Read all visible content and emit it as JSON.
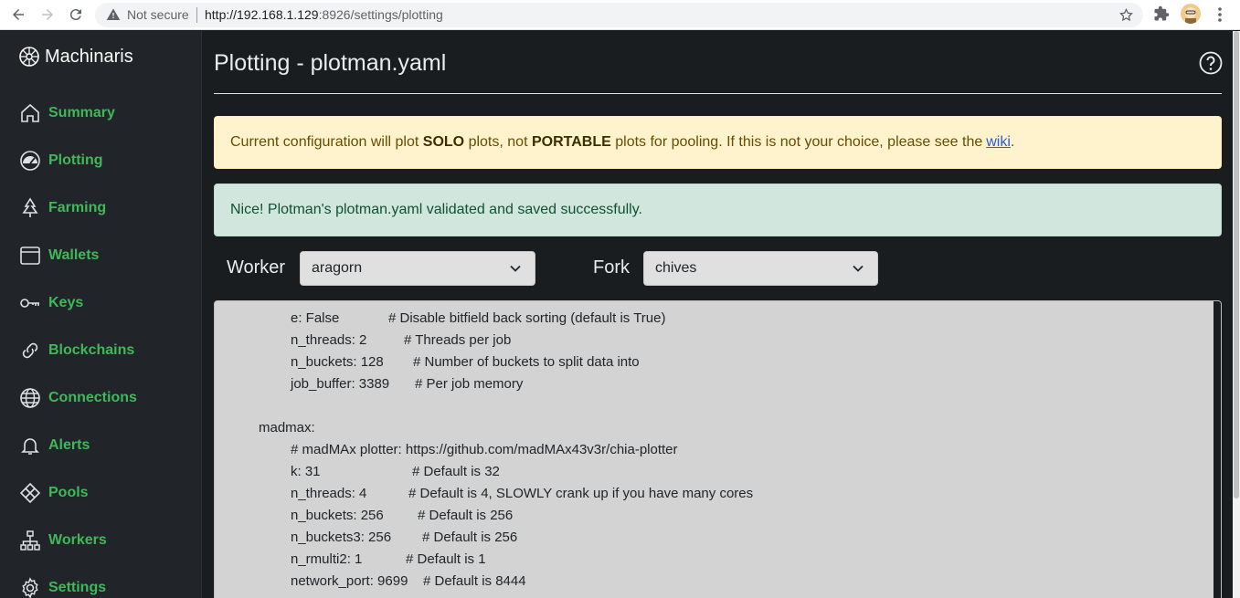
{
  "browser": {
    "security_label": "Not secure",
    "url_host": "http://192.168.1.129",
    "url_rest": ":8926/settings/plotting"
  },
  "sidebar": {
    "brand": "Machinaris",
    "items": [
      {
        "label": "Summary",
        "icon": "house-icon"
      },
      {
        "label": "Plotting",
        "icon": "speedometer-icon"
      },
      {
        "label": "Farming",
        "icon": "tree-icon"
      },
      {
        "label": "Wallets",
        "icon": "wallet-icon"
      },
      {
        "label": "Keys",
        "icon": "key-icon"
      },
      {
        "label": "Blockchains",
        "icon": "link-icon"
      },
      {
        "label": "Connections",
        "icon": "globe-icon"
      },
      {
        "label": "Alerts",
        "icon": "bell-icon"
      },
      {
        "label": "Pools",
        "icon": "diamond-icon"
      },
      {
        "label": "Workers",
        "icon": "diagram-icon"
      },
      {
        "label": "Settings",
        "icon": "gear-icon"
      }
    ],
    "accent_color": "#3fb85a"
  },
  "main": {
    "title": "Plotting - plotman.yaml",
    "warning": {
      "prefix": "Current configuration will plot",
      "solo": "SOLO",
      "middle": "plots, not",
      "portable": "PORTABLE",
      "suffix": "plots for pooling. If this is not your choice, please see the",
      "link": "wiki",
      "end": "."
    },
    "success": "Nice! Plotman's plotman.yaml validated and saved successfully.",
    "worker_label": "Worker",
    "worker_value": "aragorn",
    "fork_label": "Fork",
    "fork_value": "chives"
  },
  "editor": {
    "lines": [
      {
        "key": "e: False",
        "comment": "# Disable bitfield back sorting (default is True)"
      },
      {
        "key": "n_threads: 2",
        "comment": "# Threads per job"
      },
      {
        "key": "n_buckets: 128",
        "comment": "# Number of buckets to split data into"
      },
      {
        "key": "job_buffer: 3389",
        "comment": "# Per job memory"
      },
      {
        "key": "madmax:",
        "comment": ""
      },
      {
        "key": "# madMAx plotter: https://github.com/madMAx43v3r/chia-plotter",
        "comment": ""
      },
      {
        "key": "k: 31",
        "comment": "# Default is 32"
      },
      {
        "key": "n_threads: 4",
        "comment": "# Default is 4, SLOWLY crank up if you have many cores"
      },
      {
        "key": "n_buckets: 256",
        "comment": "# Default is 256"
      },
      {
        "key": "n_buckets3: 256",
        "comment": "# Default is 256"
      },
      {
        "key": "n_rmulti2: 1",
        "comment": "# Default is 1"
      },
      {
        "key": "network_port: 9699",
        "comment": "# Default is 8444"
      }
    ]
  }
}
